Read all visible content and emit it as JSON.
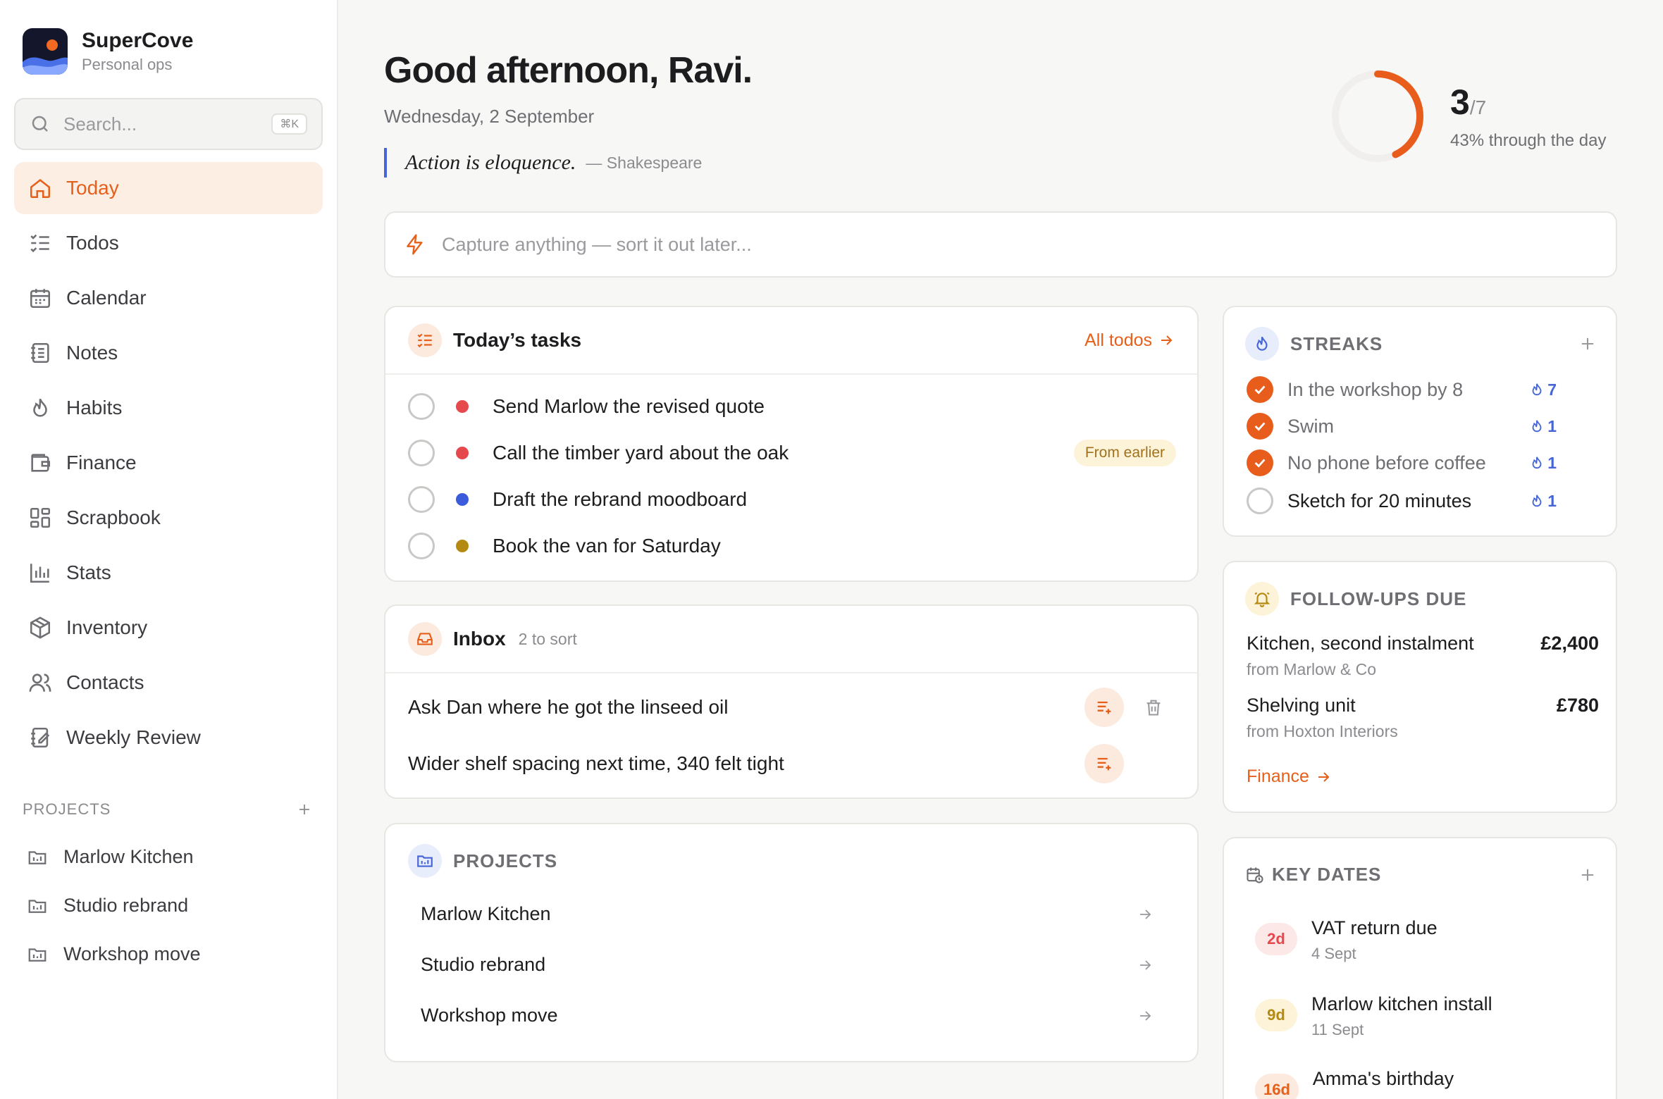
{
  "app": {
    "name": "SuperCove",
    "subtitle": "Personal ops"
  },
  "search": {
    "placeholder": "Search...",
    "shortcut": "⌘K"
  },
  "nav": [
    {
      "label": "Today",
      "icon": "home-icon",
      "active": true
    },
    {
      "label": "Todos",
      "icon": "list-check-icon"
    },
    {
      "label": "Calendar",
      "icon": "calendar-icon"
    },
    {
      "label": "Notes",
      "icon": "notebook-icon"
    },
    {
      "label": "Habits",
      "icon": "flame-icon"
    },
    {
      "label": "Finance",
      "icon": "wallet-icon"
    },
    {
      "label": "Scrapbook",
      "icon": "grid-icon"
    },
    {
      "label": "Stats",
      "icon": "bar-chart-icon"
    },
    {
      "label": "Inventory",
      "icon": "box-icon"
    },
    {
      "label": "Contacts",
      "icon": "users-icon"
    },
    {
      "label": "Weekly Review",
      "icon": "review-icon"
    }
  ],
  "sidebar_projects": {
    "label": "PROJECTS",
    "items": [
      "Marlow Kitchen",
      "Studio rebrand",
      "Workshop move"
    ]
  },
  "header": {
    "greeting": "Good afternoon, Ravi.",
    "date": "Wednesday, 2 September",
    "quote": "Action is eloquence.",
    "quote_author": "— Shakespeare"
  },
  "progress": {
    "done": "3",
    "total": "/7",
    "fraction": 0.43,
    "label": "43% through the day"
  },
  "capture": {
    "placeholder": "Capture anything — sort it out later..."
  },
  "tasks": {
    "title": "Today’s tasks",
    "link": "All todos",
    "items": [
      {
        "text": "Send Marlow the revised quote",
        "color": "#e5484d"
      },
      {
        "text": "Call the timber yard about the oak",
        "color": "#e5484d",
        "badge": "From earlier"
      },
      {
        "text": "Draft the rebrand moodboard",
        "color": "#3b5bdb"
      },
      {
        "text": "Book the van for Saturday",
        "color": "#b58a12"
      }
    ]
  },
  "inbox": {
    "title": "Inbox",
    "count": "2 to sort",
    "items": [
      "Ask Dan where he got the linseed oil",
      "Wider shelf spacing next time, 340 felt tight"
    ]
  },
  "projects_card": {
    "title": "PROJECTS",
    "items": [
      "Marlow Kitchen",
      "Studio rebrand",
      "Workshop move"
    ]
  },
  "streaks": {
    "title": "STREAKS",
    "items": [
      {
        "text": "In the workshop by 8",
        "count": "7",
        "done": true
      },
      {
        "text": "Swim",
        "count": "1",
        "done": true
      },
      {
        "text": "No phone before coffee",
        "count": "1",
        "done": true
      },
      {
        "text": "Sketch for 20 minutes",
        "count": "1",
        "done": false
      }
    ]
  },
  "followups": {
    "title": "FOLLOW-UPS DUE",
    "items": [
      {
        "name": "Kitchen, second instalment",
        "amount": "£2,400",
        "from": "from Marlow & Co"
      },
      {
        "name": "Shelving unit",
        "amount": "£780",
        "from": "from Hoxton Interiors"
      }
    ],
    "link": "Finance"
  },
  "keydates": {
    "title": "KEY DATES",
    "items": [
      {
        "badge": "2d",
        "title": "VAT return due",
        "date": "4 Sept",
        "color": "#e5484d",
        "bg": "#fde8e8"
      },
      {
        "badge": "9d",
        "title": "Marlow kitchen install",
        "date": "11 Sept",
        "color": "#b58a12",
        "bg": "#fdf3d9"
      },
      {
        "badge": "16d",
        "title": "Amma's birthday",
        "date": "",
        "color": "#e4601b",
        "bg": "#fdeadf"
      }
    ]
  },
  "colors": {
    "accent": "#e4601b",
    "blue": "#4666d8"
  }
}
